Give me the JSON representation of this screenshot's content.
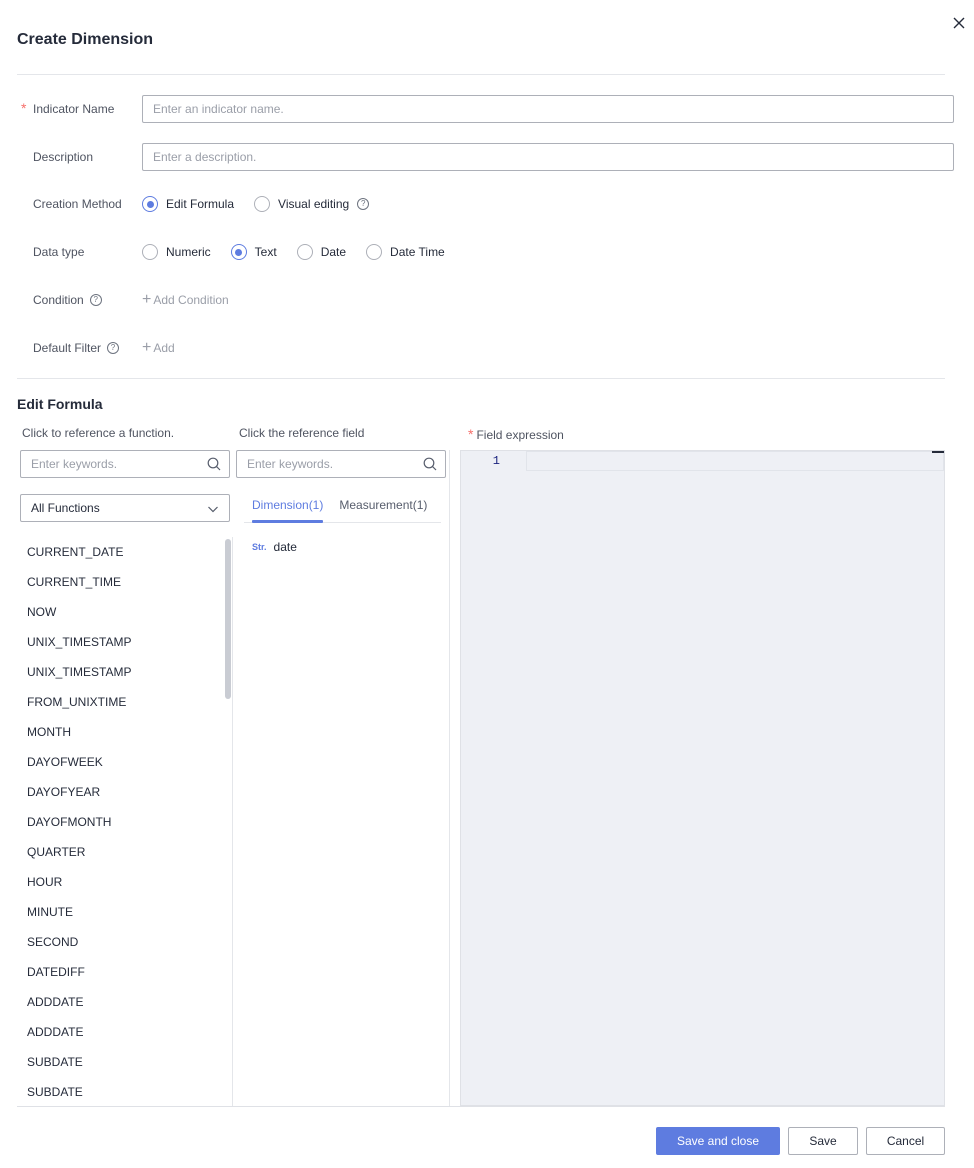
{
  "dialog": {
    "title": "Create Dimension"
  },
  "form": {
    "indicator_name": {
      "label": "Indicator Name",
      "required_mark": "*",
      "placeholder": "Enter an indicator name.",
      "value": ""
    },
    "description": {
      "label": "Description",
      "placeholder": "Enter a description.",
      "value": ""
    },
    "creation_method": {
      "label": "Creation Method",
      "options": [
        "Edit Formula",
        "Visual editing"
      ],
      "selected": "Edit Formula"
    },
    "data_type": {
      "label": "Data type",
      "options": [
        "Numeric",
        "Text",
        "Date",
        "Date Time"
      ],
      "selected": "Text"
    },
    "condition": {
      "label": "Condition",
      "add_label": "Add Condition"
    },
    "default_filter": {
      "label": "Default Filter",
      "add_label": "Add"
    }
  },
  "formula": {
    "section_title": "Edit Formula",
    "functions": {
      "header": "Click to reference a function.",
      "search_placeholder": "Enter keywords.",
      "category_selected": "All Functions",
      "items": [
        "CURRENT_DATE",
        "CURRENT_TIME",
        "NOW",
        "UNIX_TIMESTAMP",
        "UNIX_TIMESTAMP",
        "FROM_UNIXTIME",
        "MONTH",
        "DAYOFWEEK",
        "DAYOFYEAR",
        "DAYOFMONTH",
        "QUARTER",
        "HOUR",
        "MINUTE",
        "SECOND",
        "DATEDIFF",
        "ADDDATE",
        "ADDDATE",
        "SUBDATE",
        "SUBDATE"
      ]
    },
    "fields": {
      "header": "Click the reference field",
      "search_placeholder": "Enter keywords.",
      "tabs": [
        {
          "label": "Dimension(1)",
          "active": true
        },
        {
          "label": "Measurement(1)",
          "active": false
        }
      ],
      "items": [
        {
          "type": "Str.",
          "name": "date"
        }
      ]
    },
    "expression": {
      "required_mark": "*",
      "header": "Field expression",
      "line_number": "1",
      "value": ""
    }
  },
  "footer": {
    "save_and_close": "Save and close",
    "save": "Save",
    "cancel": "Cancel"
  },
  "colors": {
    "accent": "#5e7ce0",
    "required": "#f66f6a",
    "editor_bg": "#eef0f5"
  }
}
